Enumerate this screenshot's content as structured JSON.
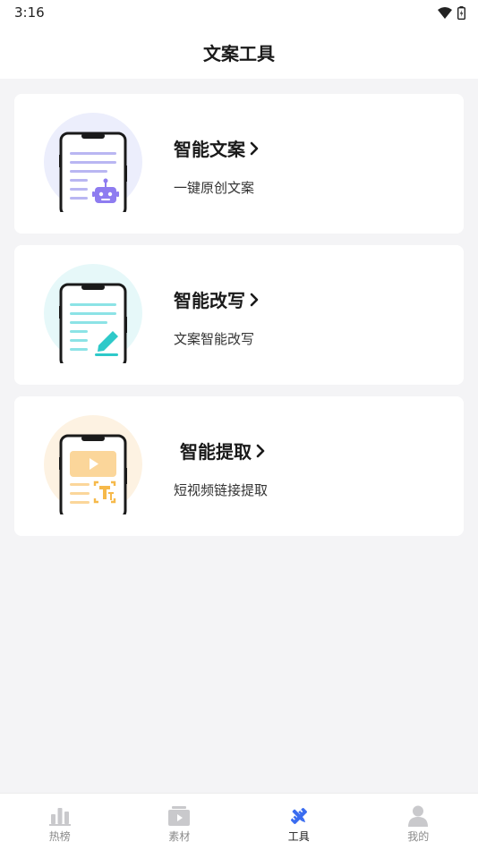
{
  "status_bar": {
    "time": "3:16"
  },
  "header": {
    "title": "文案工具"
  },
  "cards": [
    {
      "title": "智能文案",
      "description": "一键原创文案",
      "icon": "robot-phone-icon",
      "accent": "#8e7cf0"
    },
    {
      "title": "智能改写",
      "description": "文案智能改写",
      "icon": "pencil-phone-icon",
      "accent": "#2ec9c9"
    },
    {
      "title": "智能提取",
      "description": "短视频链接提取",
      "icon": "video-text-phone-icon",
      "accent": "#f6b94a"
    }
  ],
  "bottom_nav": {
    "items": [
      {
        "label": "热榜",
        "icon": "bar-chart-icon",
        "active": false
      },
      {
        "label": "素材",
        "icon": "play-folder-icon",
        "active": false
      },
      {
        "label": "工具",
        "icon": "tools-icon",
        "active": true
      },
      {
        "label": "我的",
        "icon": "person-icon",
        "active": false
      }
    ],
    "active_color": "#3a6cf0"
  }
}
